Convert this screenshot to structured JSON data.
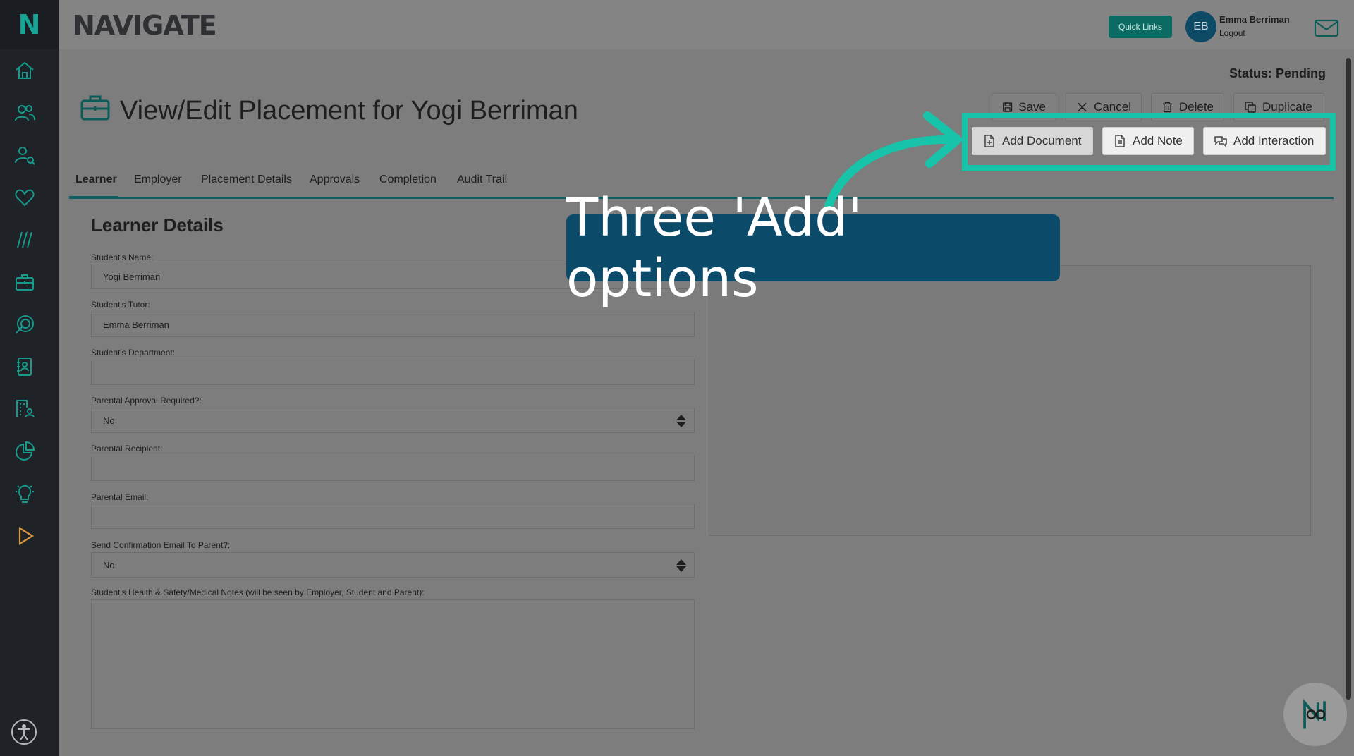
{
  "app": {
    "brand": "NAVIGATE",
    "logo_letter": "N"
  },
  "header": {
    "quick_links_label": "Quick Links",
    "avatar_initials": "EB",
    "user_name": "Emma Berriman",
    "logout_label": "Logout"
  },
  "page": {
    "status": "Status: Pending",
    "title": "View/Edit Placement for Yogi Berriman"
  },
  "actions": {
    "save": "Save",
    "cancel": "Cancel",
    "delete": "Delete",
    "duplicate": "Duplicate"
  },
  "add_actions": {
    "document": "Add Document",
    "note": "Add Note",
    "interaction": "Add Interaction"
  },
  "tabs": [
    {
      "label": "Learner",
      "active": true
    },
    {
      "label": "Employer"
    },
    {
      "label": "Placement Details"
    },
    {
      "label": "Approvals"
    },
    {
      "label": "Completion"
    },
    {
      "label": "Audit Trail"
    }
  ],
  "learner": {
    "section_title": "Learner Details",
    "name_label": "Student's Name:",
    "name_value": "Yogi Berriman",
    "tutor_label": "Student's Tutor:",
    "tutor_value": "Emma Berriman",
    "department_label": "Student's Department:",
    "department_value": "",
    "parental_approval_label": "Parental Approval Required?:",
    "parental_approval_value": "No",
    "parental_recipient_label": "Parental Recipient:",
    "parental_recipient_value": "",
    "parental_email_label": "Parental Email:",
    "parental_email_value": "",
    "send_confirmation_label": "Send Confirmation Email To Parent?:",
    "send_confirmation_value": "No",
    "health_notes_label": "Student's Health & Safety/Medical Notes (will be seen by Employer, Student and Parent):"
  },
  "callout": {
    "text": "Three 'Add' options",
    "accent": "#17c3a9",
    "bg": "#0c4a6a"
  }
}
